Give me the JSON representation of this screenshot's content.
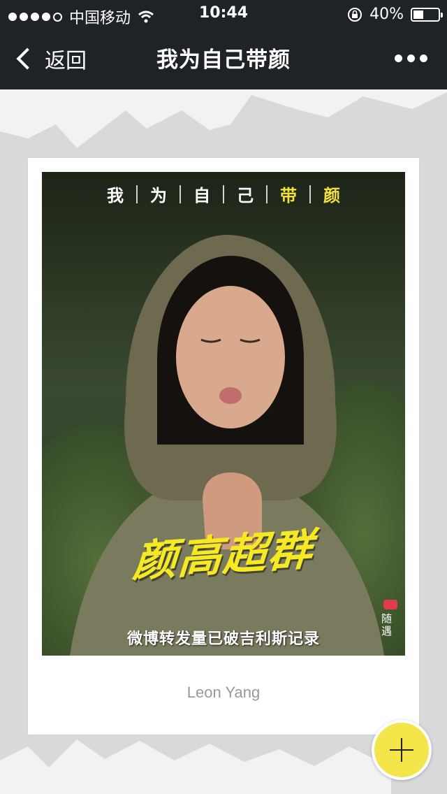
{
  "status_bar": {
    "carrier": "中国移动",
    "time": "10:44",
    "battery": "40%",
    "battery_level": 0.4
  },
  "nav": {
    "back_label": "返回",
    "title": "我为自己带颜"
  },
  "poster": {
    "headline_chars": [
      "我",
      "为",
      "自",
      "己",
      "带",
      "颜"
    ],
    "slogan": "颜高超群",
    "subline": "微博转发量已破吉利斯记录",
    "brand": "随遇"
  },
  "card": {
    "author": "Leon Yang"
  },
  "colors": {
    "accent_yellow": "#f3e54a",
    "nav_bg": "#1f2226",
    "page_bg": "#d9d9d9"
  },
  "icons": {
    "back": "chevron-left-icon",
    "more": "more-dots-icon",
    "add": "plus-icon",
    "wifi": "wifi-icon",
    "lock_rotation": "rotation-lock-icon"
  }
}
